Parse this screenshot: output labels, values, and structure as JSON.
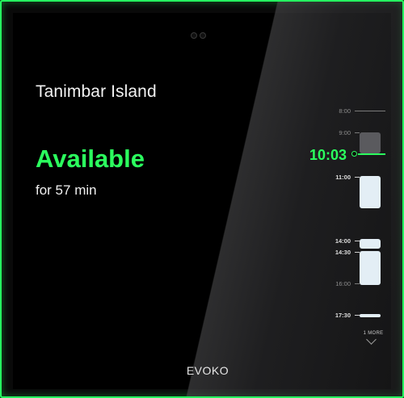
{
  "room": {
    "name": "Tanimbar Island",
    "status": "Available",
    "duration": "for 57 min"
  },
  "brand": "EVOKO",
  "timeline": {
    "current_time": "10:03",
    "hours": [
      {
        "label": "8:00",
        "dim": true
      },
      {
        "label": "9:00",
        "dim": false
      },
      {
        "label": "11:00",
        "dim": false
      },
      {
        "label": "14:00",
        "dim": false
      },
      {
        "label": "14:30",
        "dim": false
      },
      {
        "label": "16:00",
        "dim": true
      },
      {
        "label": "17:30",
        "dim": false
      }
    ],
    "more_label": "1 MORE"
  },
  "colors": {
    "accent": "#2bff5e",
    "booking": "#e3eef5",
    "past_booking": "#5a5a5e"
  }
}
